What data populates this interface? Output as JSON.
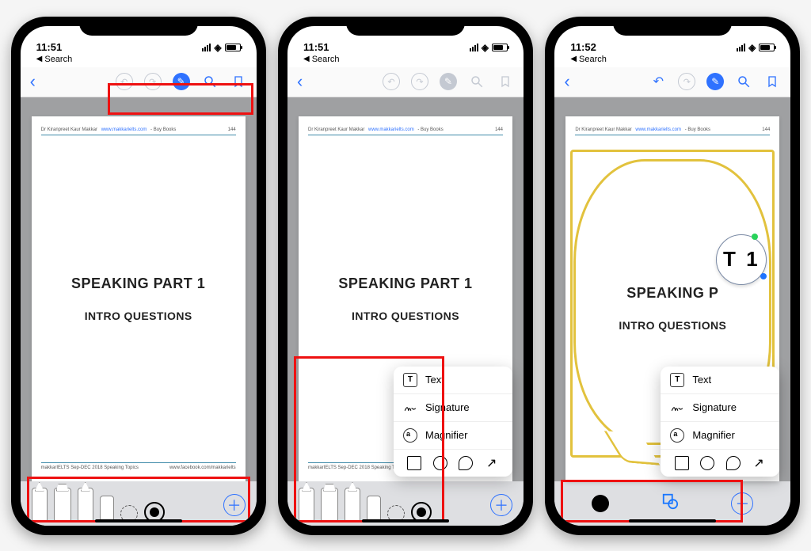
{
  "status": {
    "time1": "11:51",
    "time2": "11:51",
    "time3": "11:52",
    "back_crumb": "Search",
    "loc_arrow": "➤"
  },
  "nav": {
    "back": "‹"
  },
  "doc": {
    "author": "Dr Kiranpreet Kaur Makkar",
    "site": "www.makkarielts.com",
    "buy": " - Buy Books",
    "pagenum": "144",
    "title1": "SPEAKING PART 1",
    "title1_broken": "SPEAKING P",
    "title2": "INTRO QUESTIONS",
    "footer_left": "makkarIELTS Sep-DEC 2018 Speaking Topics",
    "footer_right": "www.facebook.com/makkarielts"
  },
  "magnifier_text": "T 1",
  "popup": {
    "text": "Text",
    "signature": "Signature",
    "magnifier": "Magnifier"
  },
  "icons": {
    "undo": "↶",
    "redo": "↷",
    "markup": "✎",
    "search": "🔍",
    "bookmark": "▯",
    "plus": "＋",
    "wifi": "▲",
    "sig_glyph": "ꕀ",
    "text_T": "T",
    "arrow": "↗",
    "shapes_combo": "◻︎"
  }
}
